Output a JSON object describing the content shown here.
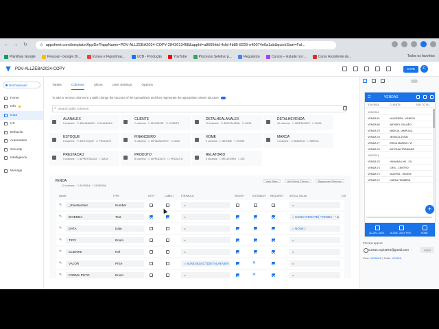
{
  "browser": {
    "url": "appsheet.com/template/AppDef?appName=PDV-ALLZEBA2024-COPY-2843613458&appId=a8605fdd-4cfd-4b85-8229-e40074e0a1ab&quickStart=Fal...",
    "bookmarks": [
      "Planilhas Google",
      "Pessoal - Google Dr...",
      "Ícones e Figurinhas...",
      "UCB - Produção",
      "YouTube",
      "Processo Seletivo p...",
      "Regularize",
      "Cursos – Estude no I...",
      "Curso Assistente de..."
    ],
    "bookmarks_right": "Todos os favoritos"
  },
  "app": {
    "name": "PDV-ALLZEBA2024-COPY",
    "save_label": "SAVE",
    "avatar_letter": "C"
  },
  "sidebar": {
    "deploy_status": "Not Deployed",
    "items": [
      {
        "label": "Home",
        "icon": "home-icon"
      },
      {
        "label": "Info",
        "icon": "info-icon"
      },
      {
        "label": "Data",
        "icon": "data-icon"
      },
      {
        "label": "UX",
        "icon": "ux-icon"
      },
      {
        "label": "Behavior",
        "icon": "behavior-icon"
      },
      {
        "label": "Automation",
        "icon": "automation-icon"
      },
      {
        "label": "Security",
        "icon": "security-icon"
      },
      {
        "label": "Intelligence",
        "icon": "intelligence-icon"
      },
      {
        "label": "Manage",
        "icon": "manage-icon"
      }
    ]
  },
  "tabs": [
    "Tables",
    "Columns",
    "Slices",
    "User Settings",
    "Options"
  ],
  "hint": "To add or remove columns in a table change the structure of the spreadsheet and then regenerate the appropriate column structure",
  "search_placeholder": "Search table columns",
  "tables": [
    {
      "name": "ALANALEX",
      "sub": "5 columns · ☐ IDALANALEX · ☐ ALANALEX"
    },
    {
      "name": "CLIENTE",
      "sub": "7 columns · ☐ IDCLIENTE · ☐ CLIENTE"
    },
    {
      "name": "DETALHEALANALEX",
      "sub": "10 columns · ☐ IDDETALHEAL · ☐ DATA"
    },
    {
      "name": "DETALHEVENDA",
      "sub": "10 columns · ☐ IDDETALHEV · ☐ DATA"
    },
    {
      "name": "ESTOQUE",
      "sub": "8 columns · ☐ IDESTOQUE · ☐ PRODUTO"
    },
    {
      "name": "FINANCEIRO",
      "sub": "9 columns · ☐ IDFINANCEIRO · ☐ DATA"
    },
    {
      "name": "HOME",
      "sub": "3 columns · ☐ IDHOME · ☐ HOME"
    },
    {
      "name": "MARCA",
      "sub": "3 columns · ☐ IDMARCA · ☐ MARCA"
    },
    {
      "name": "PRESTACAO",
      "sub": "5 columns · ☐ IDPRESTACAO · ☐ DATA"
    },
    {
      "name": "PRODUTO",
      "sub": "8 columns · ☐ IDPRODUTO · ☐ PRODUTO"
    },
    {
      "name": "RELATORIO",
      "sub": "5 columns · ☐ RELATORIO · ☐ DE"
    }
  ],
  "venda": {
    "title": "VENDA",
    "sub": "12 columns · ☐ IDVENDA · ☐ IDVENDA",
    "buttons": [
      "View Table",
      "Add Virtual Column",
      "Regenerate Structure"
    ],
    "headers": [
      "NAME",
      "TYPE",
      "KEY?",
      "LABEL?",
      "FORMULA",
      "SHOW?",
      "EDITABLE?",
      "REQUIRE?",
      "INITIAL VALUE",
      "DIS"
    ],
    "rows": [
      {
        "name": "_RowNumber",
        "type": "Number",
        "formula": "=",
        "initial": "="
      },
      {
        "name": "IDVENDA",
        "type": "Text",
        "formula": "=",
        "initial": "= CONCATENATE( \"VENDA - \" &"
      },
      {
        "name": "DATA",
        "type": "Date",
        "formula": "=",
        "initial": "= NOW( )"
      },
      {
        "name": "TIPO",
        "type": "Enum",
        "formula": "=",
        "initial": "="
      },
      {
        "name": "CLIENTE",
        "type": "Ref",
        "formula": "=",
        "initial": "="
      },
      {
        "name": "VALOR",
        "type": "Price",
        "formula": "= SUM(SELECT(DETALHEVEN",
        "initial": "="
      },
      {
        "name": "FORMA PGTO",
        "type": "Enum",
        "formula": "=",
        "initial": "="
      }
    ]
  },
  "preview": {
    "title": "VENDAS",
    "headers": [
      "IDVENDA",
      "CLIENTE",
      "SUB TOTAL"
    ],
    "rows": [
      {
        "c1": "19/5/2024",
        "c2": "",
        "group": true
      },
      {
        "c1": "VENDA 81",
        "c2": "VALDERRA - VENDIO"
      },
      {
        "c1": "VENDA 80",
        "c2": "WENDEL GALVÃO - "
      },
      {
        "c1": "VENDA 79",
        "c2": "MARCIA - AMPLIAÇ"
      },
      {
        "c1": "VENDA 78",
        "c2": "JESSICA ZOGB"
      },
      {
        "c1": "VENDA 77",
        "c2": "ERICA MARINS / VI"
      },
      {
        "c1": "VENDA 76",
        "c2": "ANTONIA TRINDADE"
      },
      {
        "c1": "19/5/2024",
        "c2": "",
        "group": true
      },
      {
        "c1": "VENDA 75",
        "c2": "HUMANA LHU - CU"
      },
      {
        "c1": "VENDA 74",
        "c2": "CRIS - CENTRO"
      },
      {
        "c1": "VENDA 73",
        "c2": "VALERIA - VAGEM"
      },
      {
        "c1": "VENDA 72",
        "c2": "CARLA ITAMBIRA"
      }
    ],
    "nav": [
      "ALLAN - ALEX",
      "ALLAN - ALEX PRO",
      "HOME"
    ],
    "preview_as_label": "Preview app as",
    "user": "cursos.ccpi1972@gmail.com",
    "apply_label": "Apply",
    "view_label": "View:",
    "view_value": "VENDAS",
    "table_label": "Table:",
    "table_value": "VENDA"
  },
  "colors": {
    "accent": "#1a73e8",
    "background": "#ffffff",
    "chrome": "#dee1e6"
  }
}
